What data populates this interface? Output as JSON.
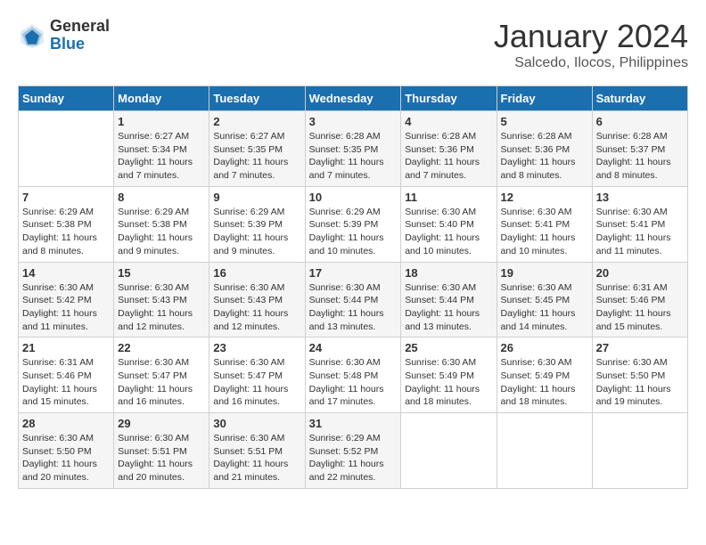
{
  "logo": {
    "general": "General",
    "blue": "Blue"
  },
  "title": {
    "month": "January 2024",
    "location": "Salcedo, Ilocos, Philippines"
  },
  "weekdays": [
    "Sunday",
    "Monday",
    "Tuesday",
    "Wednesday",
    "Thursday",
    "Friday",
    "Saturday"
  ],
  "weeks": [
    [
      {
        "day": "",
        "info": ""
      },
      {
        "day": "1",
        "info": "Sunrise: 6:27 AM\nSunset: 5:34 PM\nDaylight: 11 hours\nand 7 minutes."
      },
      {
        "day": "2",
        "info": "Sunrise: 6:27 AM\nSunset: 5:35 PM\nDaylight: 11 hours\nand 7 minutes."
      },
      {
        "day": "3",
        "info": "Sunrise: 6:28 AM\nSunset: 5:35 PM\nDaylight: 11 hours\nand 7 minutes."
      },
      {
        "day": "4",
        "info": "Sunrise: 6:28 AM\nSunset: 5:36 PM\nDaylight: 11 hours\nand 7 minutes."
      },
      {
        "day": "5",
        "info": "Sunrise: 6:28 AM\nSunset: 5:36 PM\nDaylight: 11 hours\nand 8 minutes."
      },
      {
        "day": "6",
        "info": "Sunrise: 6:28 AM\nSunset: 5:37 PM\nDaylight: 11 hours\nand 8 minutes."
      }
    ],
    [
      {
        "day": "7",
        "info": "Sunrise: 6:29 AM\nSunset: 5:38 PM\nDaylight: 11 hours\nand 8 minutes."
      },
      {
        "day": "8",
        "info": "Sunrise: 6:29 AM\nSunset: 5:38 PM\nDaylight: 11 hours\nand 9 minutes."
      },
      {
        "day": "9",
        "info": "Sunrise: 6:29 AM\nSunset: 5:39 PM\nDaylight: 11 hours\nand 9 minutes."
      },
      {
        "day": "10",
        "info": "Sunrise: 6:29 AM\nSunset: 5:39 PM\nDaylight: 11 hours\nand 10 minutes."
      },
      {
        "day": "11",
        "info": "Sunrise: 6:30 AM\nSunset: 5:40 PM\nDaylight: 11 hours\nand 10 minutes."
      },
      {
        "day": "12",
        "info": "Sunrise: 6:30 AM\nSunset: 5:41 PM\nDaylight: 11 hours\nand 10 minutes."
      },
      {
        "day": "13",
        "info": "Sunrise: 6:30 AM\nSunset: 5:41 PM\nDaylight: 11 hours\nand 11 minutes."
      }
    ],
    [
      {
        "day": "14",
        "info": "Sunrise: 6:30 AM\nSunset: 5:42 PM\nDaylight: 11 hours\nand 11 minutes."
      },
      {
        "day": "15",
        "info": "Sunrise: 6:30 AM\nSunset: 5:43 PM\nDaylight: 11 hours\nand 12 minutes."
      },
      {
        "day": "16",
        "info": "Sunrise: 6:30 AM\nSunset: 5:43 PM\nDaylight: 11 hours\nand 12 minutes."
      },
      {
        "day": "17",
        "info": "Sunrise: 6:30 AM\nSunset: 5:44 PM\nDaylight: 11 hours\nand 13 minutes."
      },
      {
        "day": "18",
        "info": "Sunrise: 6:30 AM\nSunset: 5:44 PM\nDaylight: 11 hours\nand 13 minutes."
      },
      {
        "day": "19",
        "info": "Sunrise: 6:30 AM\nSunset: 5:45 PM\nDaylight: 11 hours\nand 14 minutes."
      },
      {
        "day": "20",
        "info": "Sunrise: 6:31 AM\nSunset: 5:46 PM\nDaylight: 11 hours\nand 15 minutes."
      }
    ],
    [
      {
        "day": "21",
        "info": "Sunrise: 6:31 AM\nSunset: 5:46 PM\nDaylight: 11 hours\nand 15 minutes."
      },
      {
        "day": "22",
        "info": "Sunrise: 6:30 AM\nSunset: 5:47 PM\nDaylight: 11 hours\nand 16 minutes."
      },
      {
        "day": "23",
        "info": "Sunrise: 6:30 AM\nSunset: 5:47 PM\nDaylight: 11 hours\nand 16 minutes."
      },
      {
        "day": "24",
        "info": "Sunrise: 6:30 AM\nSunset: 5:48 PM\nDaylight: 11 hours\nand 17 minutes."
      },
      {
        "day": "25",
        "info": "Sunrise: 6:30 AM\nSunset: 5:49 PM\nDaylight: 11 hours\nand 18 minutes."
      },
      {
        "day": "26",
        "info": "Sunrise: 6:30 AM\nSunset: 5:49 PM\nDaylight: 11 hours\nand 18 minutes."
      },
      {
        "day": "27",
        "info": "Sunrise: 6:30 AM\nSunset: 5:50 PM\nDaylight: 11 hours\nand 19 minutes."
      }
    ],
    [
      {
        "day": "28",
        "info": "Sunrise: 6:30 AM\nSunset: 5:50 PM\nDaylight: 11 hours\nand 20 minutes."
      },
      {
        "day": "29",
        "info": "Sunrise: 6:30 AM\nSunset: 5:51 PM\nDaylight: 11 hours\nand 20 minutes."
      },
      {
        "day": "30",
        "info": "Sunrise: 6:30 AM\nSunset: 5:51 PM\nDaylight: 11 hours\nand 21 minutes."
      },
      {
        "day": "31",
        "info": "Sunrise: 6:29 AM\nSunset: 5:52 PM\nDaylight: 11 hours\nand 22 minutes."
      },
      {
        "day": "",
        "info": ""
      },
      {
        "day": "",
        "info": ""
      },
      {
        "day": "",
        "info": ""
      }
    ]
  ]
}
